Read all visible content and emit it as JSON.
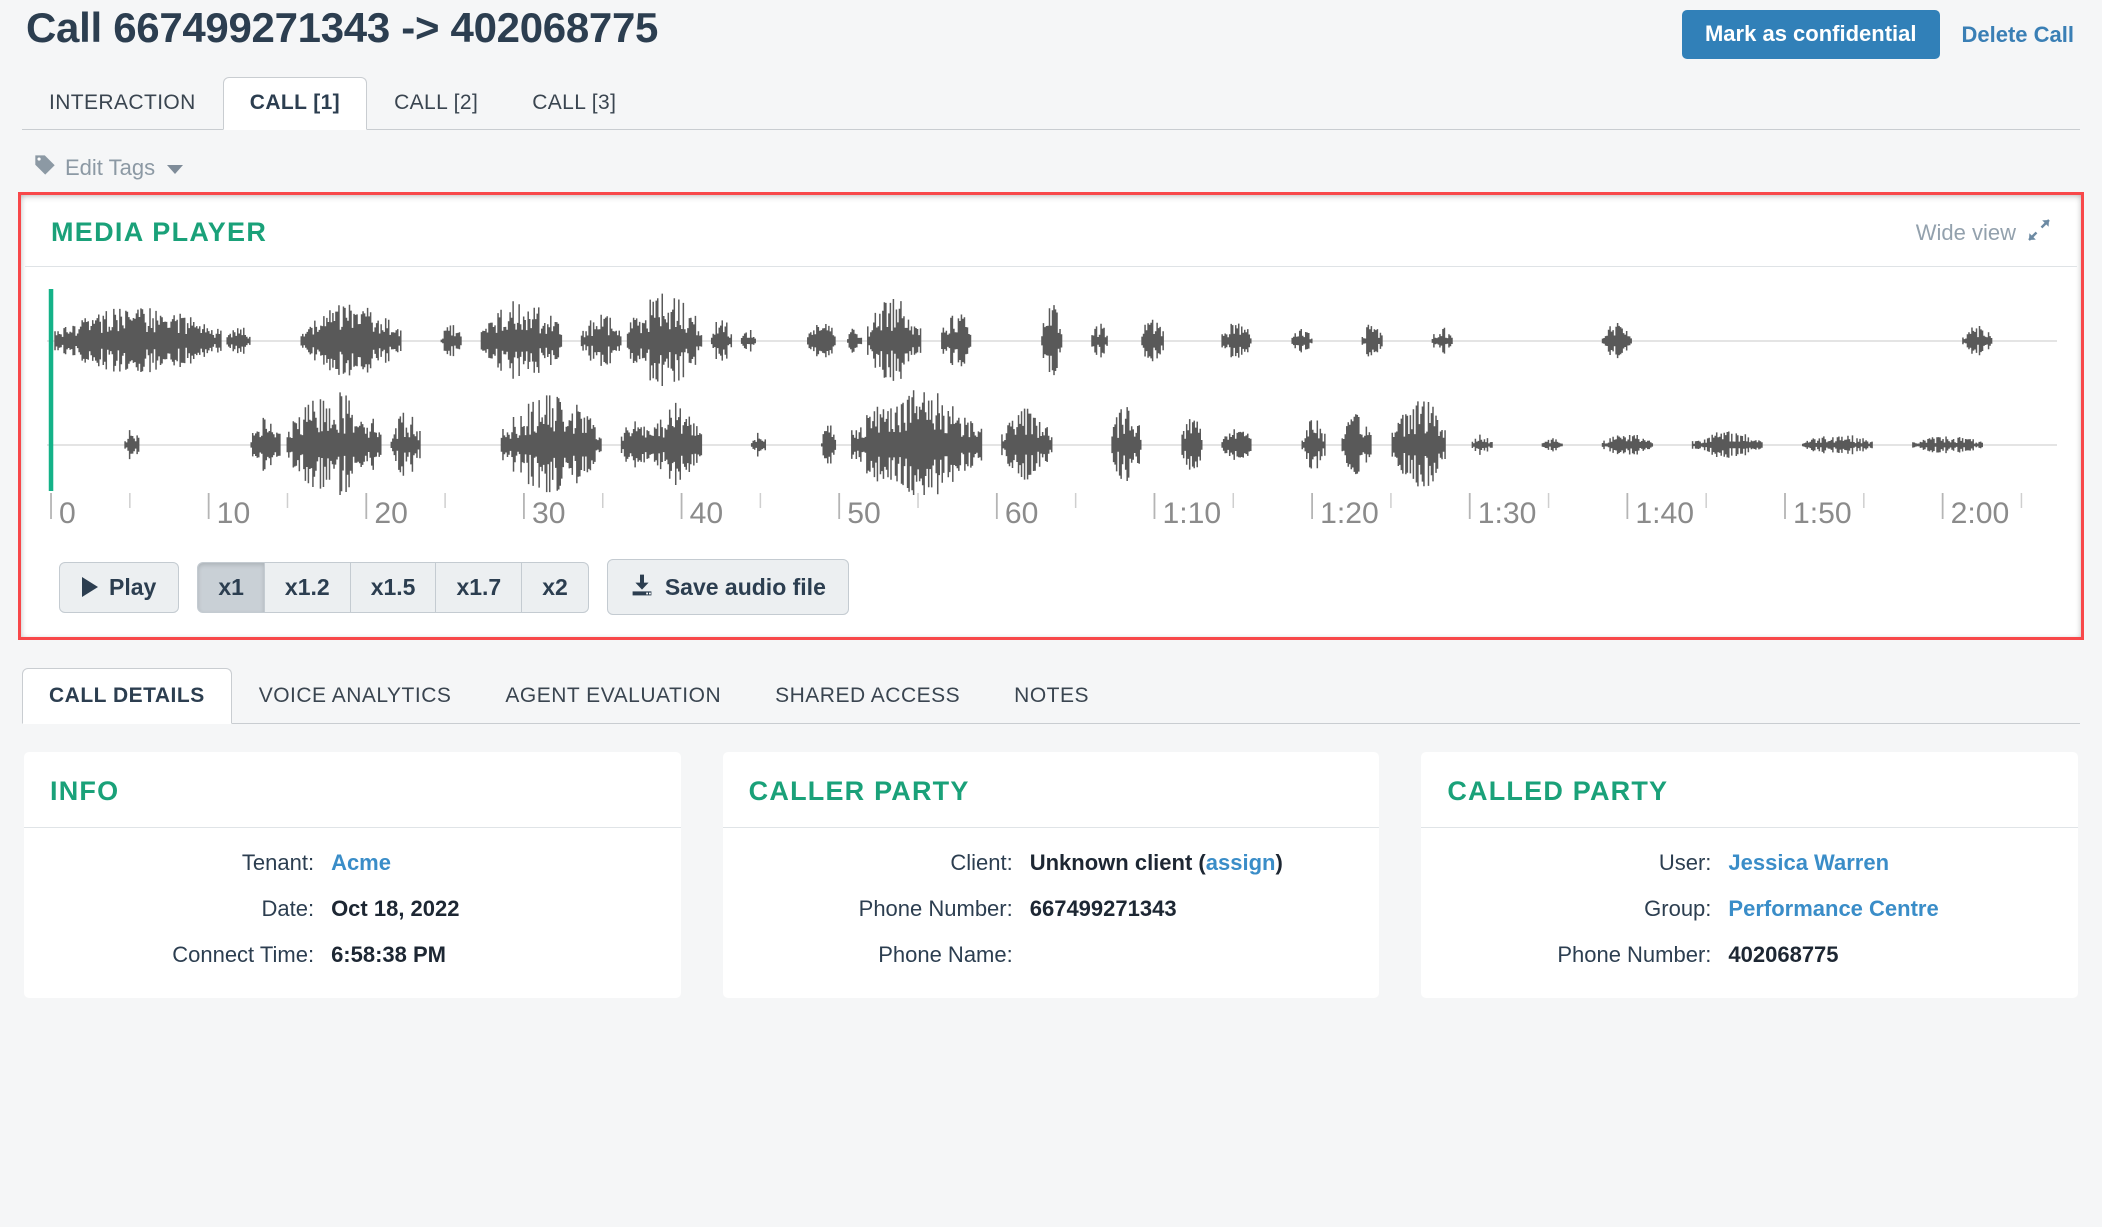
{
  "header": {
    "title": "Call 667499271343 -> 402068775",
    "mark_confidential_label": "Mark as confidential",
    "delete_call_label": "Delete Call"
  },
  "top_tabs": [
    {
      "label": "INTERACTION",
      "active": false
    },
    {
      "label": "CALL [1]",
      "active": true
    },
    {
      "label": "CALL [2]",
      "active": false
    },
    {
      "label": "CALL [3]",
      "active": false
    }
  ],
  "edit_tags": {
    "label": "Edit Tags",
    "icon": "tag-icon",
    "caret": "caret-down-icon"
  },
  "media_player": {
    "title": "MEDIA PLAYER",
    "wide_view_label": "Wide  view",
    "wide_view_icon": "expand-diagonal-icon",
    "playhead_position_seconds": 0,
    "playhead_color": "#14b288",
    "waveform_color": "#595959",
    "highlight_border_color": "#f8484a",
    "accent_color": "#1aa179",
    "timeline": {
      "duration_seconds": 127,
      "major_ticks": [
        "0",
        "10",
        "20",
        "30",
        "40",
        "50",
        "60",
        "1:10",
        "1:20",
        "1:30",
        "1:40",
        "1:50",
        "2:00"
      ],
      "major_tick_interval_seconds": 10,
      "minor_tick_interval_seconds": 5
    },
    "controls": {
      "play_label": "Play",
      "play_icon": "play-icon",
      "speeds": [
        {
          "label": "x1",
          "active": true
        },
        {
          "label": "x1.2",
          "active": false
        },
        {
          "label": "x1.5",
          "active": false
        },
        {
          "label": "x1.7",
          "active": false
        },
        {
          "label": "x2",
          "active": false
        }
      ],
      "save_audio_label": "Save audio file",
      "save_audio_icon": "download-icon"
    }
  },
  "bottom_tabs": [
    {
      "label": "CALL DETAILS",
      "active": true
    },
    {
      "label": "VOICE ANALYTICS",
      "active": false
    },
    {
      "label": "AGENT EVALUATION",
      "active": false
    },
    {
      "label": "SHARED ACCESS",
      "active": false
    },
    {
      "label": "NOTES",
      "active": false
    }
  ],
  "cards": {
    "info": {
      "title": "INFO",
      "rows": [
        {
          "label": "Tenant:",
          "value": "Acme",
          "is_link": true
        },
        {
          "label": "Date:",
          "value": "Oct 18, 2022",
          "is_link": false
        },
        {
          "label": "Connect Time:",
          "value": "6:58:38 PM",
          "is_link": false
        }
      ]
    },
    "caller_party": {
      "title": "CALLER PARTY",
      "client_label": "Client:",
      "client_value": "Unknown client",
      "client_assign_label": "assign",
      "rows": [
        {
          "label": "Phone Number:",
          "value": "667499271343",
          "is_link": false
        },
        {
          "label": "Phone Name:",
          "value": "",
          "is_link": false
        }
      ]
    },
    "called_party": {
      "title": "CALLED PARTY",
      "rows": [
        {
          "label": "User:",
          "value": "Jessica Warren",
          "is_link": true
        },
        {
          "label": "Group:",
          "value": "Performance Centre",
          "is_link": true
        },
        {
          "label": "Phone Number:",
          "value": "402068775",
          "is_link": false
        }
      ]
    }
  }
}
